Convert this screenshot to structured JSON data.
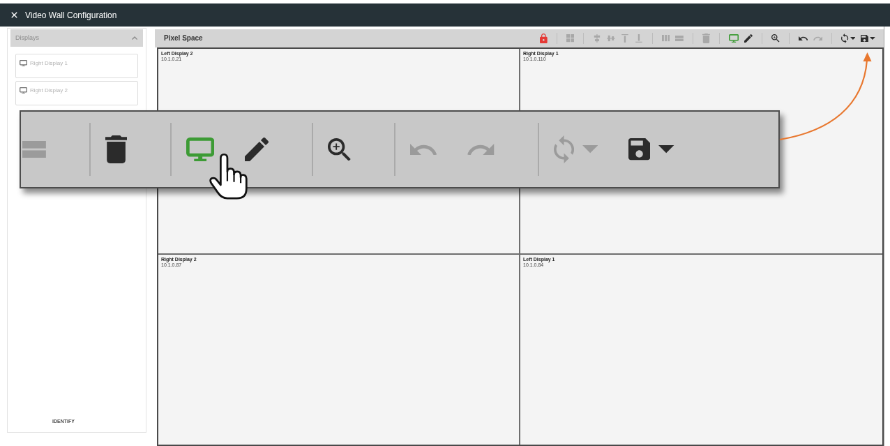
{
  "window": {
    "title": "Video Wall Configuration"
  },
  "sidebar": {
    "title": "Displays",
    "expanded": true,
    "items": [
      {
        "label": "Right Display 1"
      },
      {
        "label": "Right Display 2"
      }
    ],
    "footer_button": "IDENTIFY"
  },
  "pixel_space": {
    "title": "Pixel Space",
    "toolbar": [
      [
        {
          "kind": "lock",
          "selected": false,
          "disabled": false
        }
      ],
      [
        {
          "kind": "grid",
          "selected": false,
          "disabled": true
        }
      ],
      [
        {
          "kind": "align_center",
          "selected": false,
          "disabled": true
        },
        {
          "kind": "align_middle",
          "selected": false,
          "disabled": true
        },
        {
          "kind": "align_top",
          "selected": false,
          "disabled": true
        },
        {
          "kind": "align_bottom",
          "selected": false,
          "disabled": true
        }
      ],
      [
        {
          "kind": "columns",
          "selected": false,
          "disabled": true
        },
        {
          "kind": "rows",
          "selected": false,
          "disabled": true
        }
      ],
      [
        {
          "kind": "trash",
          "selected": false,
          "disabled": true
        }
      ],
      [
        {
          "kind": "monitor",
          "selected": true,
          "disabled": false
        },
        {
          "kind": "pencil",
          "selected": false,
          "disabled": false
        }
      ],
      [
        {
          "kind": "zoom",
          "selected": false,
          "disabled": false
        }
      ],
      [
        {
          "kind": "undo",
          "selected": false,
          "disabled": false
        },
        {
          "kind": "redo",
          "selected": false,
          "disabled": true
        }
      ],
      [
        {
          "kind": "sync",
          "selected": false,
          "disabled": false,
          "dropdown": true
        },
        {
          "kind": "save",
          "selected": false,
          "disabled": false,
          "dropdown": true
        }
      ]
    ],
    "displays": [
      {
        "name": "Left Display 2",
        "ip": "10.1.0.21"
      },
      {
        "name": "Right Display 1",
        "ip": "10.1.0.110"
      },
      {
        "name": "Right Display 2",
        "ip": "10.1.0.87"
      },
      {
        "name": "Left Display 1",
        "ip": "10.1.0.84"
      }
    ]
  },
  "callout": {
    "toolbar": [
      [
        {
          "kind": "rows",
          "selected": false,
          "disabled": true
        }
      ],
      [
        {
          "kind": "trash",
          "selected": false,
          "disabled": false
        }
      ],
      [
        {
          "kind": "monitor",
          "selected": true,
          "disabled": false
        },
        {
          "kind": "pencil",
          "selected": false,
          "disabled": false
        }
      ],
      [
        {
          "kind": "zoom",
          "selected": false,
          "disabled": false
        }
      ],
      [
        {
          "kind": "undo",
          "selected": false,
          "disabled": true
        },
        {
          "kind": "redo",
          "selected": false,
          "disabled": true
        }
      ],
      [
        {
          "kind": "sync",
          "selected": false,
          "disabled": true,
          "dropdown": true
        },
        {
          "kind": "save",
          "selected": false,
          "disabled": false,
          "dropdown": true
        }
      ]
    ],
    "cursor_shown": true
  }
}
